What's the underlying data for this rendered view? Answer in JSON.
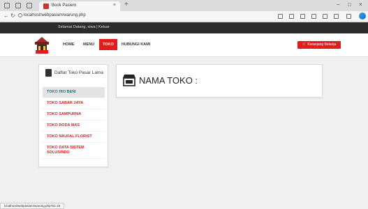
{
  "browser": {
    "tab_title": "Book Pasiem",
    "tab_close": "×",
    "new_tab": "+",
    "url": "localhost/webpasiam/warung.php",
    "window_controls": [
      "–",
      "□",
      "×"
    ],
    "status_url": "localhost/webpasiam/warung.php?id=18"
  },
  "site": {
    "topbar_text": "Selamat Datang, siwa  |  Keluar",
    "nav": {
      "home": "HOME",
      "menu": "MENU",
      "toko": "TOKO",
      "hubungi": "HUBUNGI KAMI"
    },
    "cart_label": "Keranjang Belanja",
    "accent_color": "#e01c1c"
  },
  "sidebar": {
    "title": "Daftar Toko Pasar Lama",
    "items": [
      "TOKO HIO BENI",
      "TOKO SABAR JAYA",
      "TOKO SAMPURNA",
      "TOKO RODA MAS",
      "TOKO NAUFAL FLORIST",
      "TOKO DATA SISTEM SOLUSINDO"
    ],
    "active_index": 0
  },
  "main": {
    "title": "NAMA TOKO :",
    "icon": "store-icon"
  }
}
